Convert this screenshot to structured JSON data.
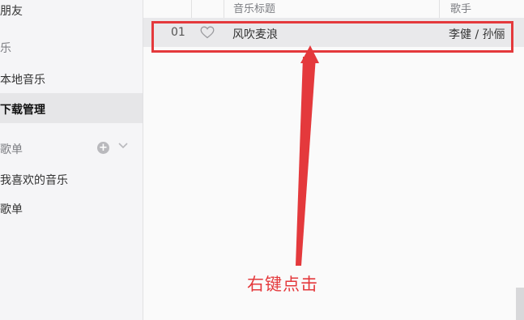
{
  "sidebar": {
    "friends": "朋友",
    "music_section": "乐",
    "local_music": "本地音乐",
    "downloads": "下载管理",
    "playlists_section": "歌单",
    "liked_music": "我喜欢的音乐",
    "playlist": "歌单",
    "add_symbol": "+"
  },
  "table": {
    "headers": {
      "title": "音乐标题",
      "artist": "歌手"
    },
    "rows": [
      {
        "index": "01",
        "title": "风吹麦浪",
        "artist": "李健 / 孙俪"
      }
    ]
  },
  "annotation": {
    "text": "右键点击"
  },
  "colors": {
    "annotation_red": "#e4393c",
    "selected_row": "#e9e9eb"
  }
}
